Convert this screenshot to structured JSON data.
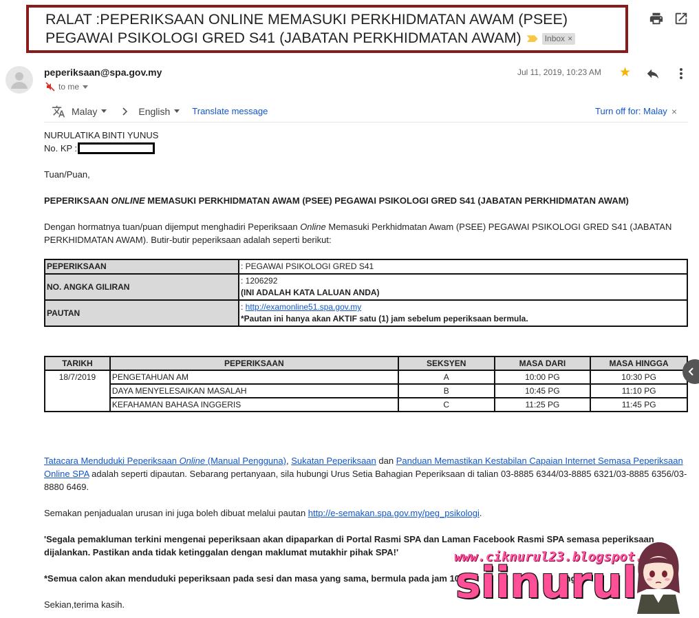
{
  "email": {
    "subject": "RALAT :PEPERIKSAAN ONLINE MEMASUKI PERKHIDMATAN AWAM (PSEE) PEGAWAI PSIKOLOGI GRED S41 (JABATAN PERKHIDMATAN AWAM)",
    "label_chip": "Inbox",
    "sender": "peperiksaan@spa.gov.my",
    "recipient": "to me",
    "date": "Jul 11, 2019, 10:23 AM"
  },
  "translate": {
    "from_lang": "Malay",
    "to_lang": "English",
    "translate_link": "Translate message",
    "turn_off": "Turn off for: Malay"
  },
  "body": {
    "name": "NURULATIKA BINTI YUNUS",
    "kp_label": "No. KP :",
    "greeting": "Tuan/Puan,",
    "heading_a": "PEPERIKSAAN ",
    "heading_online": "ONLINE",
    "heading_b": " MEMASUKI PERKHIDMATAN AWAM (PSEE) PEGAWAI PSIKOLOGI GRED S41 (JABATAN PERKHIDMATAN AWAM)",
    "intro_a": "Dengan hormatnya tuan/puan dijemput menghadiri Peperiksaan ",
    "intro_online": "Online",
    "intro_b": " Memasuki Perkhidmatan Awam (PSEE) PEGAWAI PSIKOLOGI GRED S41 (JABATAN PERKHIDMATAN AWAM). Butir-butir peperiksaan adalah seperti berikut:",
    "link1_a": "Tatacara Menduduki Peperiksaan ",
    "link1_online": "Online",
    "link1_b": " (Manual Pengguna)",
    "sep1": ", ",
    "link2": "Sukatan Peperiksaan",
    "sep2": " dan ",
    "link3": "Panduan Memastikan Kestabilan Capaian Internet Semasa Peperiksaan Online SPA",
    "contact_text": " adalah seperti dipautan. Sebarang pertanyaan, sila hubungi Urus Setia Bahagian Peperiksaan di talian 03-8885 6344/03-8885 6321/03-8885 6356/03-8880 6469.",
    "semakan_text": "Semakan penjadualan urusan ini juga boleh dibuat melalui pautan ",
    "semakan_link": "http://e-semakan.spa.gov.my/peg_psikologi",
    "semakan_end": ".",
    "notice": "'Segala pemakluman terkini mengenai peperiksaan akan dipaparkan di Portal Rasmi SPA dan Laman Facebook Rasmi SPA semasa peperiksaan dijalankan. Pastikan anda tidak ketinggalan dengan maklumat mutakhir pihak SPA!'",
    "note": "*Semua calon akan menduduki peperiksaan pada sesi dan masa yang sama, bermula pada jam 10",
    "note_tail": "mg",
    "closing": "Sekian,terima kasih."
  },
  "info_table": {
    "row1_label": "PEPERIKSAAN",
    "row1_value": ": PEGAWAI PSIKOLOGI GRED S41",
    "row2_label": "NO. ANGKA GILIRAN",
    "row2_value": ": 1206292",
    "row2_note": "(INI ADALAH KATA LALUAN ANDA)",
    "row3_label": "PAUTAN",
    "row3_prefix": ": ",
    "row3_link": "http://examonline51.spa.gov.my",
    "row3_note": "*Pautan ini hanya akan AKTIF satu (1) jam sebelum peperiksaan bermula."
  },
  "schedule": {
    "headers": [
      "TARIKH",
      "PEPERIKSAAN",
      "SEKSYEN",
      "MASA DARI",
      "MASA HINGGA"
    ],
    "date": "18/7/2019",
    "rows": [
      [
        "PENGETAHUAN AM",
        "A",
        "10:00 PG",
        "10:30 PG"
      ],
      [
        "DAYA MENYELESAIKAN MASALAH",
        "B",
        "10:45 PG",
        "11:10 PG"
      ],
      [
        "KEFAHAMAN BAHASA INGGERIS",
        "C",
        "11:25 PG",
        "11:45 PG"
      ]
    ]
  },
  "watermark": {
    "url": "www.ciknurul23.blogspot.com",
    "name": "siinurul"
  },
  "icons": [
    "print-icon",
    "open-new-window-icon",
    "avatar-icon",
    "muted-icon",
    "star-icon",
    "reply-icon",
    "more-vert-icon",
    "translate-icon",
    "chevron-right-icon"
  ],
  "colors": {
    "frame": "#8b1a1a",
    "link": "#1155cc",
    "star": "#f4b400",
    "table_header": "#d9d9d9"
  }
}
